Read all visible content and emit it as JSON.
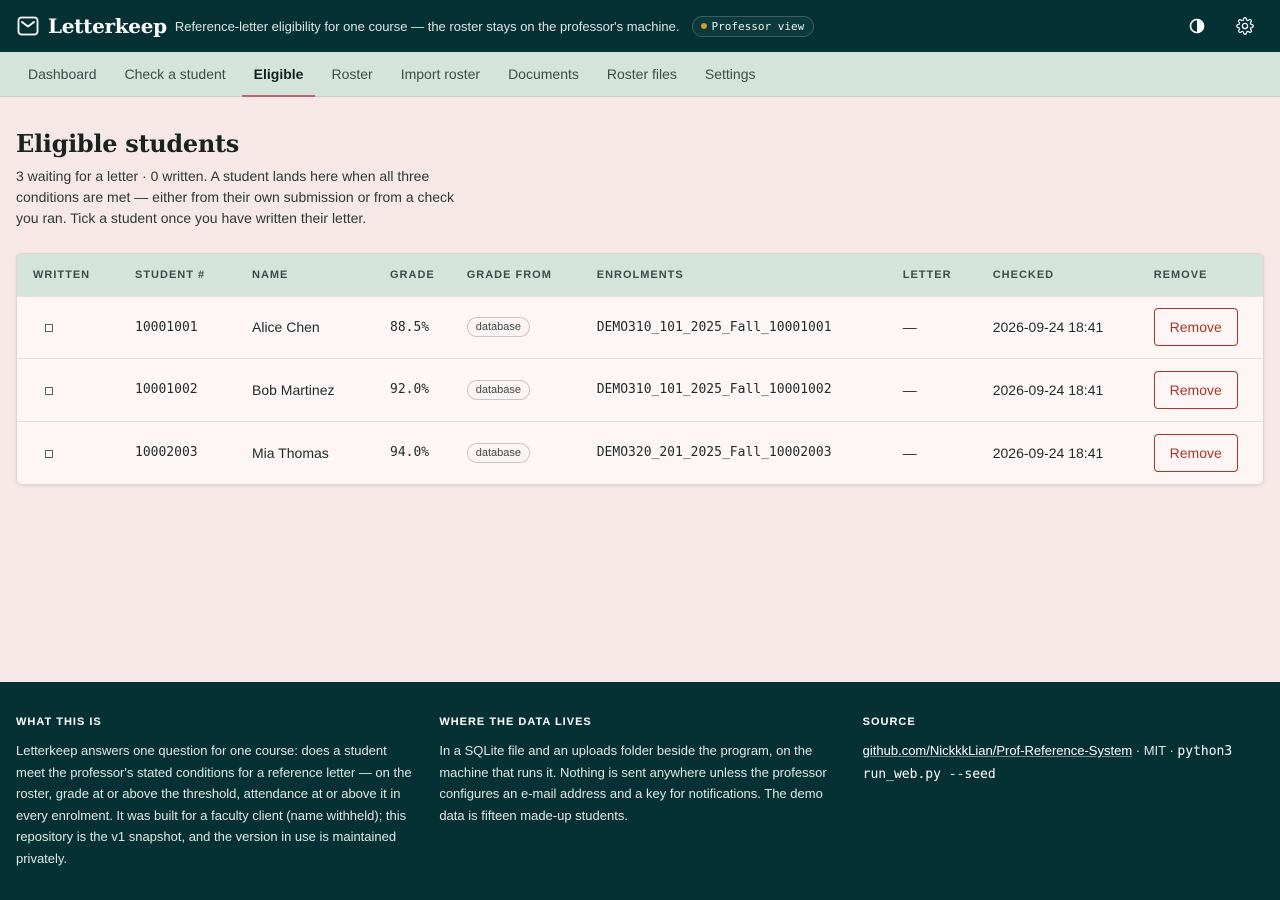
{
  "header": {
    "app_name": "Letterkeep",
    "tagline": "Reference-letter eligibility for one course — the roster stays on the professor's machine.",
    "role_badge": "Professor view",
    "icons": [
      "mail-icon",
      "contrast-icon",
      "gear-icon"
    ]
  },
  "nav": {
    "items": [
      {
        "label": "Dashboard"
      },
      {
        "label": "Check a student"
      },
      {
        "label": "Eligible"
      },
      {
        "label": "Roster"
      },
      {
        "label": "Import roster"
      },
      {
        "label": "Documents"
      },
      {
        "label": "Roster files"
      },
      {
        "label": "Settings"
      }
    ],
    "active": "Eligible"
  },
  "page": {
    "title": "Eligible students",
    "description": "3 waiting for a letter · 0 written. A student lands here when all three conditions are met — either from their own submission or from a check you ran. Tick a student once you have written their letter."
  },
  "table": {
    "headers": {
      "written": "WRITTEN",
      "student_no": "STUDENT #",
      "name": "NAME",
      "grade": "GRADE",
      "grade_from": "GRADE FROM",
      "enrolments": "ENROLMENTS",
      "letter": "LETTER",
      "checked": "CHECKED",
      "remove": "REMOVE"
    },
    "rows": [
      {
        "written": "☐",
        "student_no": "10001001",
        "name": "Alice Chen",
        "grade": "88.5%",
        "grade_from": "database",
        "enrolments": "DEMO310_101_2025_Fall_10001001",
        "letter": "—",
        "checked": "2026-09-24 18:41",
        "remove_label": "Remove"
      },
      {
        "written": "☐",
        "student_no": "10001002",
        "name": "Bob Martinez",
        "grade": "92.0%",
        "grade_from": "database",
        "enrolments": "DEMO310_101_2025_Fall_10001002",
        "letter": "—",
        "checked": "2026-09-24 18:41",
        "remove_label": "Remove"
      },
      {
        "written": "☐",
        "student_no": "10002003",
        "name": "Mia Thomas",
        "grade": "94.0%",
        "grade_from": "database",
        "enrolments": "DEMO320_201_2025_Fall_10002003",
        "letter": "—",
        "checked": "2026-09-24 18:41",
        "remove_label": "Remove"
      }
    ]
  },
  "footer": {
    "what": {
      "title": "WHAT THIS IS",
      "text": "Letterkeep answers one question for one course: does a student meet the professor's stated conditions for a reference letter — on the roster, grade at or above the threshold, attendance at or above it in every enrolment. It was built for a faculty client (name withheld); this repository is the v1 snapshot, and the version in use is maintained privately."
    },
    "where": {
      "title": "WHERE THE DATA LIVES",
      "text": "In a SQLite file and an uploads folder beside the program, on the machine that runs it. Nothing is sent anywhere unless the professor configures an e-mail address and a key for notifications. The demo data is fifteen made-up students."
    },
    "source": {
      "title": "SOURCE",
      "link": "github.com/NickkkLian/Prof-Reference-System",
      "sep": " · MIT · ",
      "command": "python3 run_web.py --seed"
    }
  },
  "colors": {
    "header_bg": "#063134",
    "nav_bg": "#d4e4da",
    "page_bg": "#f5e8e7",
    "active_underline": "#c5616d",
    "remove_accent": "#a6372a",
    "role_dot": "#d39a2e"
  }
}
